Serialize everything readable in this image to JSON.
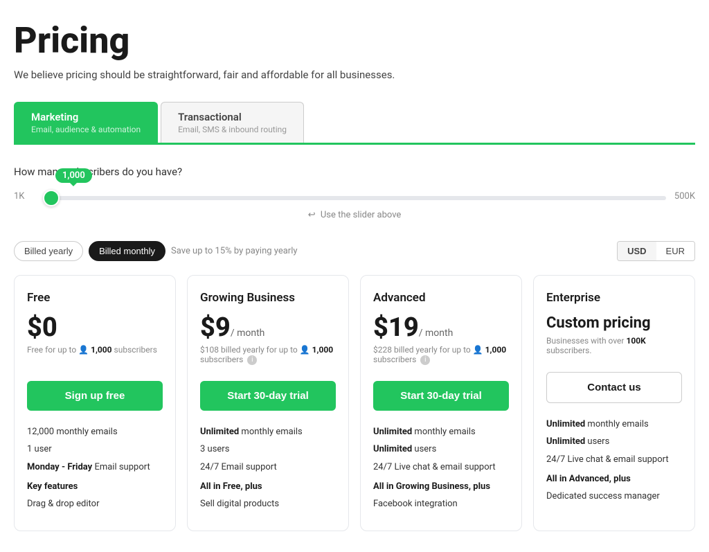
{
  "header": {
    "title": "Pricing",
    "subtitle": "We believe pricing should be straightforward, fair and affordable for all businesses."
  },
  "tabs": [
    {
      "id": "marketing",
      "label": "Marketing",
      "sub": "Email, audience & automation",
      "active": true
    },
    {
      "id": "transactional",
      "label": "Transactional",
      "sub": "Email, SMS & inbound routing",
      "active": false
    }
  ],
  "slider": {
    "question": "How many subscribers do you have?",
    "value": 1000,
    "tooltip": "1,000",
    "min_label": "1K",
    "max_label": "500K",
    "hint": "Use the slider above"
  },
  "billing": {
    "yearly_label": "Billed yearly",
    "monthly_label": "Billed monthly",
    "save_text": "Save up to 15% by paying yearly",
    "currency_usd": "USD",
    "currency_eur": "EUR",
    "active": "monthly"
  },
  "plans": [
    {
      "id": "free",
      "name": "Free",
      "price": "$0",
      "price_period": "",
      "billing_note": "Free for up to 👤 1,000 subscribers",
      "cta_label": "Sign up free",
      "cta_type": "green",
      "features": [
        {
          "text": "12,000 monthly emails",
          "bold_part": ""
        },
        {
          "text": "1 user",
          "bold_part": ""
        },
        {
          "text": "Monday - Friday Email support",
          "bold_part": "Monday - Friday"
        },
        {
          "text": "Key features",
          "is_section": true
        },
        {
          "text": "Drag & drop editor",
          "bold_part": ""
        }
      ]
    },
    {
      "id": "growing",
      "name": "Growing Business",
      "price": "$9",
      "price_period": "/ month",
      "billing_note": "$108 billed yearly for up to 👤 1,000 subscribers ⓘ",
      "cta_label": "Start 30-day trial",
      "cta_type": "green",
      "features": [
        {
          "text": "Unlimited monthly emails",
          "bold_part": "Unlimited"
        },
        {
          "text": "3 users",
          "bold_part": ""
        },
        {
          "text": "24/7 Email support",
          "bold_part": ""
        },
        {
          "text": "All in Free, plus",
          "is_section": true
        },
        {
          "text": "Sell digital products",
          "bold_part": ""
        }
      ]
    },
    {
      "id": "advanced",
      "name": "Advanced",
      "price": "$19",
      "price_period": "/ month",
      "billing_note": "$228 billed yearly for up to 👤 1,000 subscribers ⓘ",
      "cta_label": "Start 30-day trial",
      "cta_type": "green",
      "features": [
        {
          "text": "Unlimited monthly emails",
          "bold_part": "Unlimited"
        },
        {
          "text": "Unlimited users",
          "bold_part": "Unlimited"
        },
        {
          "text": "24/7 Live chat & email support",
          "bold_part": ""
        },
        {
          "text": "All in Growing Business, plus",
          "is_section": true
        },
        {
          "text": "Facebook integration",
          "bold_part": ""
        }
      ]
    },
    {
      "id": "enterprise",
      "name": "Enterprise",
      "price": "Custom pricing",
      "price_period": "",
      "billing_note": "Businesses with over 100K subscribers.",
      "cta_label": "Contact us",
      "cta_type": "outline",
      "features": [
        {
          "text": "Unlimited monthly emails",
          "bold_part": "Unlimited"
        },
        {
          "text": "Unlimited users",
          "bold_part": "Unlimited"
        },
        {
          "text": "24/7 Live chat & email support",
          "bold_part": ""
        },
        {
          "text": "All in Advanced, plus",
          "is_section": true
        },
        {
          "text": "Dedicated success manager",
          "bold_part": ""
        }
      ]
    }
  ]
}
